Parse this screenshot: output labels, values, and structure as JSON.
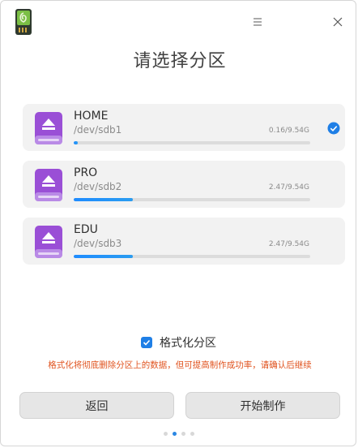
{
  "window": {
    "title": "请选择分区",
    "app_icon": "usb-drive-logo-icon",
    "menu_icon": "hamburger-menu-icon",
    "close_icon": "close-icon"
  },
  "partitions": [
    {
      "name": "HOME",
      "device": "/dev/sdb1",
      "size": "0.16/9.54G",
      "usage_fraction": 0.017,
      "selected": true
    },
    {
      "name": "PRO",
      "device": "/dev/sdb2",
      "size": "2.47/9.54G",
      "usage_fraction": 0.25,
      "selected": false
    },
    {
      "name": "EDU",
      "device": "/dev/sdb3",
      "size": "2.47/9.54G",
      "usage_fraction": 0.25,
      "selected": false
    }
  ],
  "format_option": {
    "label": "格式化分区",
    "checked": true
  },
  "warning": "格式化将彻底删除分区上的数据，但可提高制作成功率，请确认后继续",
  "buttons": {
    "back": "返回",
    "start": "开始制作"
  },
  "pager": {
    "count": 4,
    "active_index": 1
  },
  "colors": {
    "accent": "#1f7fe6",
    "warning": "#e0531f",
    "drive_icon": "#9a4fd6"
  }
}
